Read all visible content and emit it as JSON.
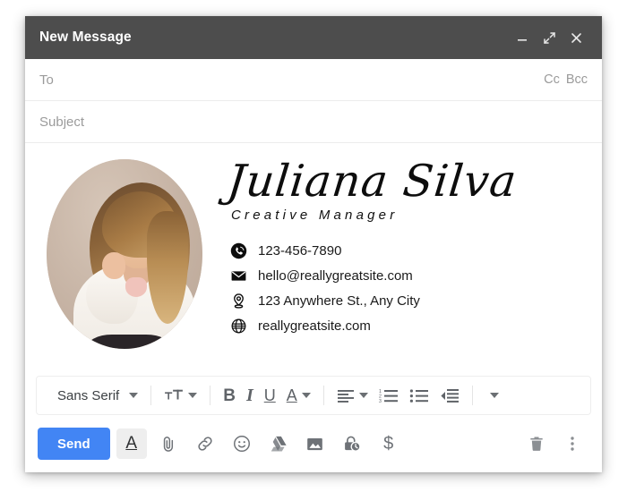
{
  "window": {
    "title": "New Message",
    "controls": [
      {
        "name": "minimize",
        "icon": "minimize-icon"
      },
      {
        "name": "expand",
        "icon": "expand-icon"
      },
      {
        "name": "close",
        "icon": "close-icon"
      }
    ]
  },
  "fields": {
    "to": {
      "placeholder": "To",
      "value": ""
    },
    "cc": "Cc",
    "bcc": "Bcc",
    "subject": {
      "placeholder": "Subject",
      "value": ""
    }
  },
  "signature": {
    "name": "Juliana Silva",
    "role": "Creative Manager",
    "contacts": [
      {
        "icon": "phone-icon",
        "text": "123-456-7890"
      },
      {
        "icon": "envelope-icon",
        "text": "hello@reallygreatsite.com"
      },
      {
        "icon": "location-pin-icon",
        "text": "123 Anywhere St., Any City"
      },
      {
        "icon": "globe-icon",
        "text": "reallygreatsite.com"
      }
    ],
    "portrait_alt": "portrait-photo"
  },
  "format_toolbar": {
    "font_family": "Sans Serif",
    "items": [
      {
        "name": "font-family-selector",
        "label": "Sans Serif"
      },
      {
        "name": "font-size-button",
        "label": ""
      },
      {
        "name": "bold-button",
        "label": "B"
      },
      {
        "name": "italic-button",
        "label": "I"
      },
      {
        "name": "underline-button",
        "label": "U"
      },
      {
        "name": "text-color-button",
        "label": "A"
      },
      {
        "name": "align-button",
        "label": ""
      },
      {
        "name": "numbered-list-button",
        "label": ""
      },
      {
        "name": "bulleted-list-button",
        "label": ""
      },
      {
        "name": "indent-less-button",
        "label": ""
      },
      {
        "name": "more-format-button",
        "label": ""
      }
    ]
  },
  "action_bar": {
    "send_label": "Send",
    "icons": [
      {
        "name": "formatting-options-icon",
        "label": "A",
        "active": true
      },
      {
        "name": "attach-file-icon",
        "label": ""
      },
      {
        "name": "insert-link-icon",
        "label": ""
      },
      {
        "name": "insert-emoji-icon",
        "label": ""
      },
      {
        "name": "google-drive-icon",
        "label": ""
      },
      {
        "name": "insert-photo-icon",
        "label": ""
      },
      {
        "name": "confidential-mode-icon",
        "label": ""
      },
      {
        "name": "insert-signature-icon",
        "label": "$"
      }
    ],
    "right_icons": [
      {
        "name": "discard-draft-icon"
      },
      {
        "name": "more-options-icon"
      }
    ]
  },
  "colors": {
    "titlebar": "#4d4d4d",
    "send_button": "#4285f4",
    "icon_gray": "#5f6368",
    "placeholder": "#9b9b9b"
  }
}
